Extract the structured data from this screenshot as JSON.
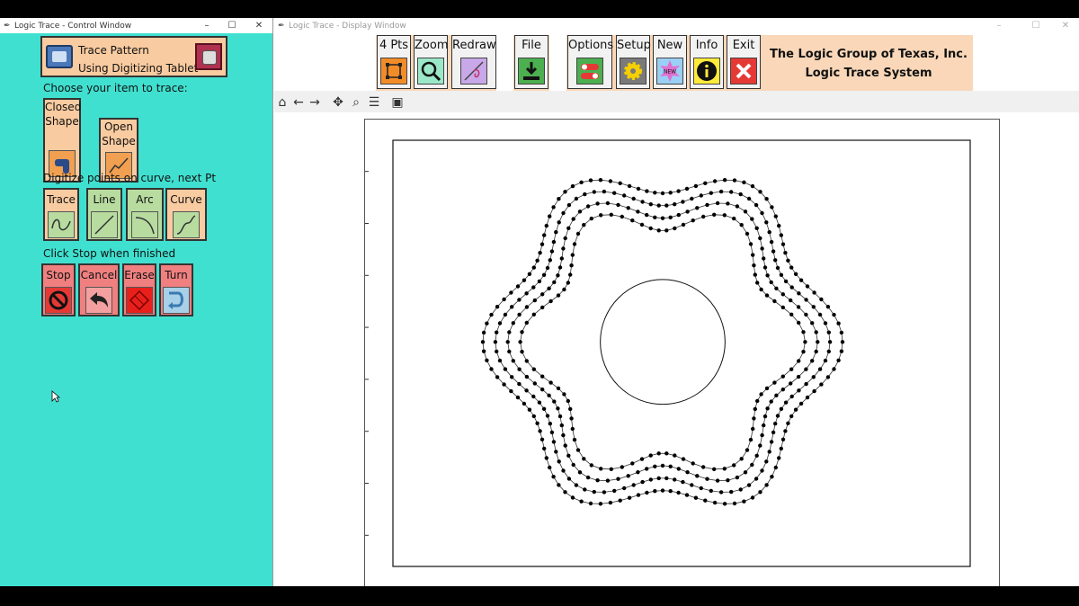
{
  "control_window": {
    "title": "Logic Trace - Control Window",
    "trace_pattern": {
      "line1": "Trace Pattern",
      "line2": "Using Digitizing Tablet"
    },
    "choose_label": "Choose your item to trace:",
    "shape_buttons": [
      {
        "line1": "Closed",
        "line2": "Shape",
        "icon": "closed-shape-icon"
      },
      {
        "line1": "Open",
        "line2": "Shape",
        "icon": "open-shape-icon"
      }
    ],
    "digitize_label": "Digitize points on curve, next Pt",
    "digitize_buttons": [
      {
        "label": "Trace",
        "icon": "trace-icon"
      },
      {
        "label": "Line",
        "icon": "line-icon"
      },
      {
        "label": "Arc",
        "icon": "arc-icon"
      },
      {
        "label": "Curve",
        "icon": "curve-icon"
      }
    ],
    "stop_label": "Click Stop when finished",
    "action_buttons": [
      {
        "label": "Stop",
        "icon": "stop-icon"
      },
      {
        "label": "Cancel",
        "icon": "undo-arrow-icon"
      },
      {
        "label": "Erase",
        "icon": "erase-icon"
      },
      {
        "label": "Turn",
        "icon": "turn-arrow-icon"
      }
    ]
  },
  "display_window": {
    "title": "Logic Trace - Display Window",
    "toolbar": [
      {
        "label": "4 Pts",
        "icon": "four-points-icon",
        "color": "#f28c28"
      },
      {
        "label": "Zoom",
        "icon": "magnifier-icon",
        "color": "#9be8c8"
      },
      {
        "label": "Redraw",
        "icon": "redraw-icon",
        "color": "#c8a8e8"
      },
      {
        "label": "File",
        "icon": "download-icon",
        "color": "#4caf50"
      },
      {
        "label": "Options",
        "icon": "toggle-icon",
        "color": "#4caf50"
      },
      {
        "label": "Setup",
        "icon": "gear-icon",
        "color": "#7a7a7a"
      },
      {
        "label": "New",
        "icon": "new-badge-icon",
        "color": "#9ad0f5"
      },
      {
        "label": "Info",
        "icon": "info-icon",
        "color": "#ffeb3b"
      },
      {
        "label": "Exit",
        "icon": "close-icon",
        "color": "#e53935"
      }
    ],
    "company": {
      "line1": "The Logic Group of Texas, Inc.",
      "line2": "Logic Trace System"
    },
    "nav_icons": [
      "home-icon",
      "back-icon",
      "forward-icon",
      "pan-icon",
      "zoom-icon",
      "configure-icon",
      "save-icon"
    ]
  },
  "chart_data": {
    "type": "scatter",
    "title": "",
    "xlabel": "",
    "ylabel": "",
    "ylim": [
      1.0,
      21.5
    ],
    "yticks": [
      "20.0",
      "17.5",
      "15.0",
      "12.5",
      "10.0",
      "7.5",
      "5.0",
      "2.5"
    ],
    "grid": false,
    "center": [
      0,
      11.8
    ],
    "inner_circle_radius": 3.0,
    "traced_loops": [
      {
        "petals": 6,
        "base_radius": 7.9,
        "amplitude": 0.75,
        "points": 120
      },
      {
        "petals": 6,
        "base_radius": 7.3,
        "amplitude": 0.75,
        "points": 110
      },
      {
        "petals": 6,
        "base_radius": 6.7,
        "amplitude": 0.75,
        "points": 100
      },
      {
        "petals": 6,
        "base_radius": 6.1,
        "amplitude": 0.75,
        "points": 90
      }
    ]
  }
}
